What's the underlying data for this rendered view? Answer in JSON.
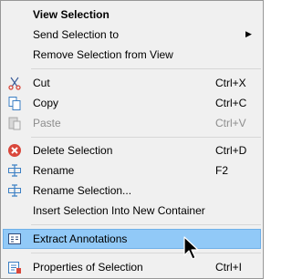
{
  "menu": {
    "view_selection": "View Selection",
    "send_selection_to": "Send Selection to",
    "remove_selection": "Remove Selection from View",
    "cut": "Cut",
    "cut_shortcut": "Ctrl+X",
    "copy": "Copy",
    "copy_shortcut": "Ctrl+C",
    "paste": "Paste",
    "paste_shortcut": "Ctrl+V",
    "delete_selection": "Delete Selection",
    "delete_shortcut": "Ctrl+D",
    "rename": "Rename",
    "rename_shortcut": "F2",
    "rename_selection": "Rename Selection...",
    "insert_selection": "Insert Selection Into New Container",
    "extract_annotations": "Extract Annotations",
    "properties_of_selection": "Properties of Selection",
    "properties_shortcut": "Ctrl+I"
  },
  "icons": {
    "cut": "scissors-icon",
    "copy": "copy-icon",
    "paste": "paste-icon",
    "delete": "delete-icon",
    "rename": "rename-icon",
    "rename_selection": "rename-selection-icon",
    "extract": "extract-annotations-icon",
    "properties": "properties-icon",
    "submenu": "chevron-right-icon",
    "cursor": "mouse-pointer-icon"
  },
  "colors": {
    "menu_bg": "#f0f0f0",
    "highlight": "#91c9f7",
    "delete_red": "#d9473b",
    "icon_blue": "#3b7fc4"
  }
}
